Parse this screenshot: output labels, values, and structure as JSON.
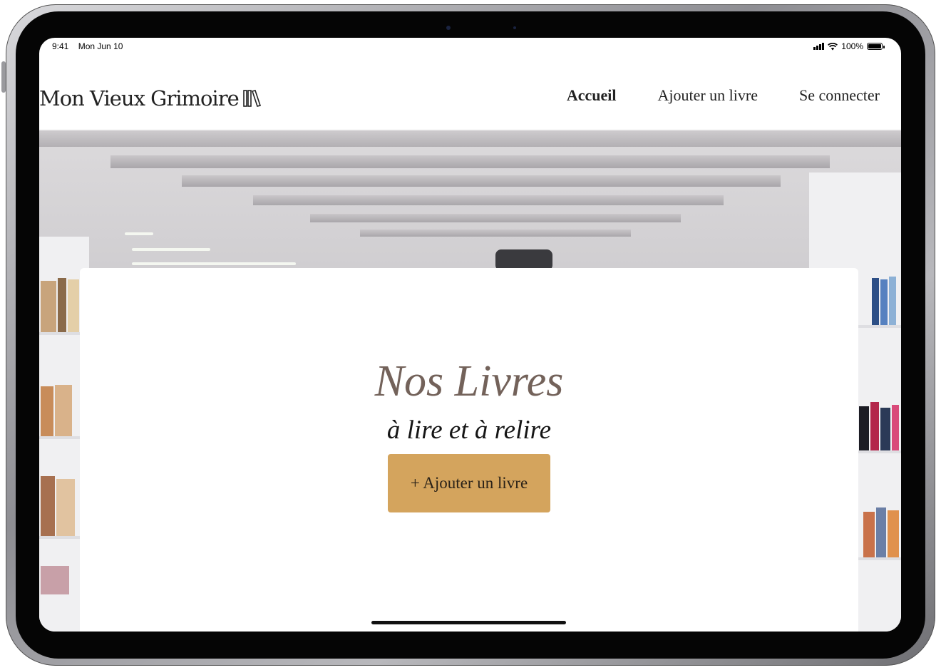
{
  "status_bar": {
    "time": "9:41",
    "date": "Mon Jun 10",
    "battery": "100%",
    "battery_level": 1.0
  },
  "header": {
    "logo_text": "Mon Vieux Grimoire",
    "logo_icon": "books-icon",
    "nav": [
      {
        "label": "Accueil",
        "active": true
      },
      {
        "label": "Ajouter un livre",
        "active": false
      },
      {
        "label": "Se connecter",
        "active": false
      }
    ]
  },
  "hero": {
    "title": "Nos Livres",
    "subtitle": "à lire et à relire",
    "button_label": "+ Ajouter un livre",
    "button_color": "#d4a45d",
    "title_color": "#73625a"
  }
}
